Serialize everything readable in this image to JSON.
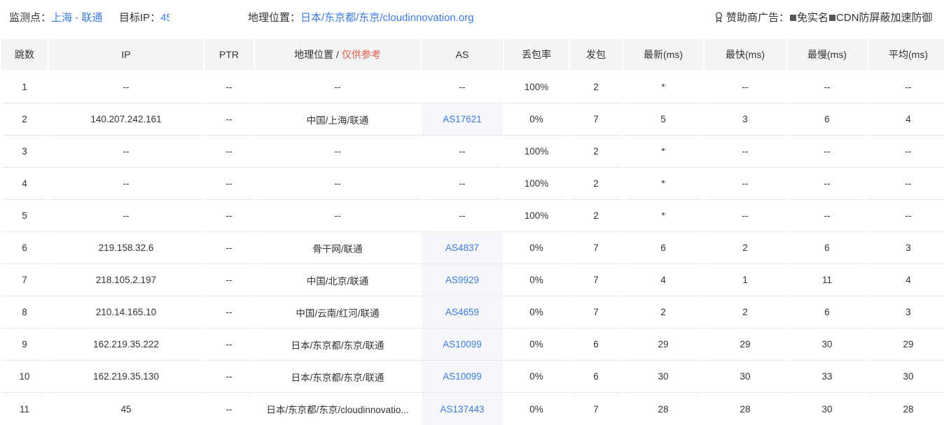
{
  "top": {
    "monitor_label": "监测点：",
    "monitor_value": "上海 - 联通",
    "target_label": "目标IP：",
    "target_value": "45",
    "geo_label": "地理位置：",
    "geo_value": "日本/东京都/东京/cloudinnovation.org",
    "sponsor_label": "赞助商广告：",
    "sponsor_ad1": "免实名",
    "sponsor_ad2": "CDN防屏蔽加速防御"
  },
  "table": {
    "headers": {
      "hop": "跳数",
      "ip": "IP",
      "ptr": "PTR",
      "geo": "地理位置 / ",
      "geo_ref": "仅供参考",
      "as": "AS",
      "loss": "丢包率",
      "sent": "发包",
      "last": "最新(ms)",
      "best": "最快(ms)",
      "worst": "最慢(ms)",
      "avg": "平均(ms)"
    },
    "rows": [
      {
        "hop": "1",
        "ip": "--",
        "ptr": "--",
        "geo": "--",
        "as": "--",
        "loss": "100%",
        "sent": "2",
        "last": "*",
        "best": "--",
        "worst": "--",
        "avg": "--"
      },
      {
        "hop": "2",
        "ip": "140.207.242.161",
        "ptr": "--",
        "geo": "中国/上海/联通",
        "as": "AS17621",
        "loss": "0%",
        "sent": "7",
        "last": "5",
        "best": "3",
        "worst": "6",
        "avg": "4"
      },
      {
        "hop": "3",
        "ip": "--",
        "ptr": "--",
        "geo": "--",
        "as": "--",
        "loss": "100%",
        "sent": "2",
        "last": "*",
        "best": "--",
        "worst": "--",
        "avg": "--"
      },
      {
        "hop": "4",
        "ip": "--",
        "ptr": "--",
        "geo": "--",
        "as": "--",
        "loss": "100%",
        "sent": "2",
        "last": "*",
        "best": "--",
        "worst": "--",
        "avg": "--"
      },
      {
        "hop": "5",
        "ip": "--",
        "ptr": "--",
        "geo": "--",
        "as": "--",
        "loss": "100%",
        "sent": "2",
        "last": "*",
        "best": "--",
        "worst": "--",
        "avg": "--"
      },
      {
        "hop": "6",
        "ip": "219.158.32.6",
        "ptr": "--",
        "geo": "骨干网/联通",
        "as": "AS4837",
        "loss": "0%",
        "sent": "7",
        "last": "6",
        "best": "2",
        "worst": "6",
        "avg": "3"
      },
      {
        "hop": "7",
        "ip": "218.105.2.197",
        "ptr": "--",
        "geo": "中国/北京/联通",
        "as": "AS9929",
        "loss": "0%",
        "sent": "7",
        "last": "4",
        "best": "1",
        "worst": "11",
        "avg": "4"
      },
      {
        "hop": "8",
        "ip": "210.14.165.10",
        "ptr": "--",
        "geo": "中国/云南/红河/联通",
        "as": "AS4659",
        "loss": "0%",
        "sent": "7",
        "last": "2",
        "best": "2",
        "worst": "6",
        "avg": "3"
      },
      {
        "hop": "9",
        "ip": "162.219.35.222",
        "ptr": "--",
        "geo": "日本/东京都/东京/联通",
        "as": "AS10099",
        "loss": "0%",
        "sent": "6",
        "last": "29",
        "best": "29",
        "worst": "30",
        "avg": "29"
      },
      {
        "hop": "10",
        "ip": "162.219.35.130",
        "ptr": "--",
        "geo": "日本/东京都/东京/联通",
        "as": "AS10099",
        "loss": "0%",
        "sent": "6",
        "last": "30",
        "best": "30",
        "worst": "33",
        "avg": "30"
      },
      {
        "hop": "11",
        "ip": "45",
        "ptr": "--",
        "geo": "日本/东京都/东京/cloudinnovatio...",
        "as": "AS137443",
        "loss": "0%",
        "sent": "7",
        "last": "28",
        "best": "28",
        "worst": "30",
        "avg": "28"
      }
    ]
  },
  "colors": {
    "link": "#3b7bdc",
    "reference_note": "#e05a4b",
    "header_bg": "#f3f4f6"
  }
}
